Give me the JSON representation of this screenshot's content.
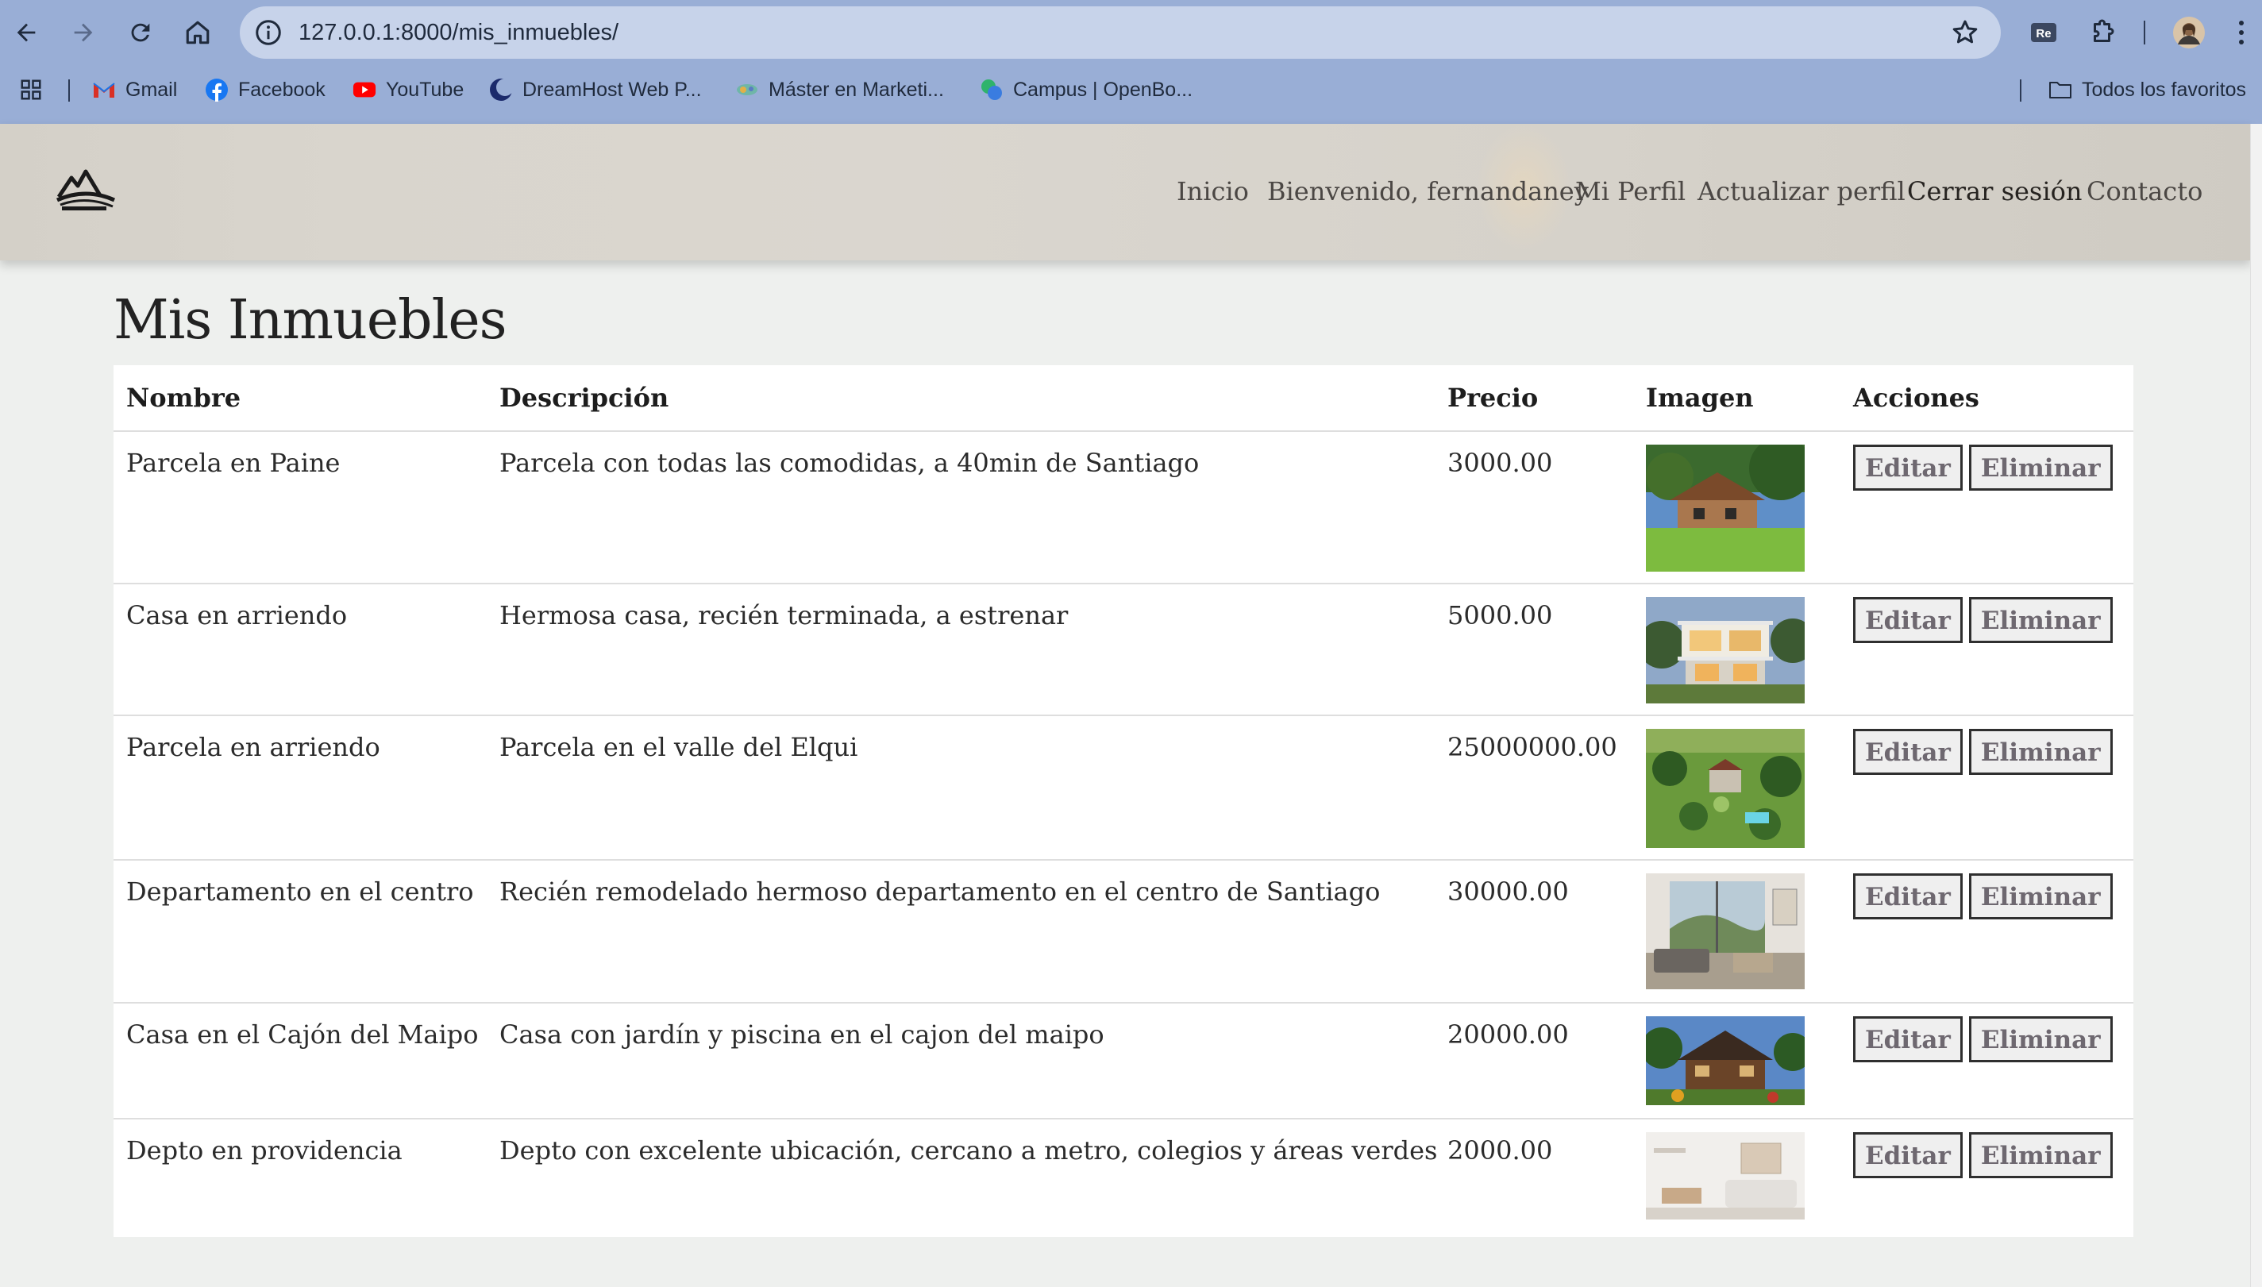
{
  "browser": {
    "url": "127.0.0.1:8000/mis_inmuebles/",
    "bookmarks": [
      {
        "label": "Gmail",
        "icon": "gmail-icon"
      },
      {
        "label": "Facebook",
        "icon": "facebook-icon"
      },
      {
        "label": "YouTube",
        "icon": "youtube-icon"
      },
      {
        "label": "DreamHost Web P...",
        "icon": "dreamhost-icon"
      },
      {
        "label": "Máster en Marketi...",
        "icon": "marketing-icon"
      },
      {
        "label": "Campus | OpenBo...",
        "icon": "openbootcamp-icon"
      }
    ],
    "all_bookmarks_label": "Todos los favoritos"
  },
  "site": {
    "nav": {
      "inicio": "Inicio",
      "bienvenido": "Bienvenido, fernandaney",
      "mi_perfil": "Mi Perfil",
      "actualizar": "Actualizar perfil",
      "cerrar": "Cerrar sesión",
      "contacto": "Contacto"
    }
  },
  "page": {
    "title": "Mis Inmuebles",
    "headers": {
      "nombre": "Nombre",
      "descripcion": "Descripción",
      "precio": "Precio",
      "imagen": "Imagen",
      "acciones": "Acciones"
    },
    "edit_label": "Editar",
    "delete_label": "Eliminar",
    "rows": [
      {
        "nombre": "Parcela en Paine",
        "descripcion": "Parcela con todas las comodidas, a 40min de Santiago",
        "precio": "3000.00",
        "image": "house-lawn"
      },
      {
        "nombre": "Casa en arriendo",
        "descripcion": "Hermosa casa, recién terminada, a estrenar",
        "precio": "5000.00",
        "image": "modern-house"
      },
      {
        "nombre": "Parcela en arriendo",
        "descripcion": "Parcela en el valle del Elqui",
        "precio": "25000000.00",
        "image": "aerial-parcel"
      },
      {
        "nombre": "Departamento en el centro",
        "descripcion": "Recién remodelado hermoso departamento en el centro de Santiago",
        "precio": "30000.00",
        "image": "apartment-interior"
      },
      {
        "nombre": "Casa en el Cajón del Maipo",
        "descripcion": "Casa con jardín y piscina en el cajon del maipo",
        "precio": "20000.00",
        "image": "wood-house"
      },
      {
        "nombre": "Depto en providencia",
        "descripcion": "Depto con excelente ubicación, cercano a metro, colegios y áreas verdes",
        "precio": "2000.00",
        "image": "white-livingroom"
      }
    ]
  }
}
